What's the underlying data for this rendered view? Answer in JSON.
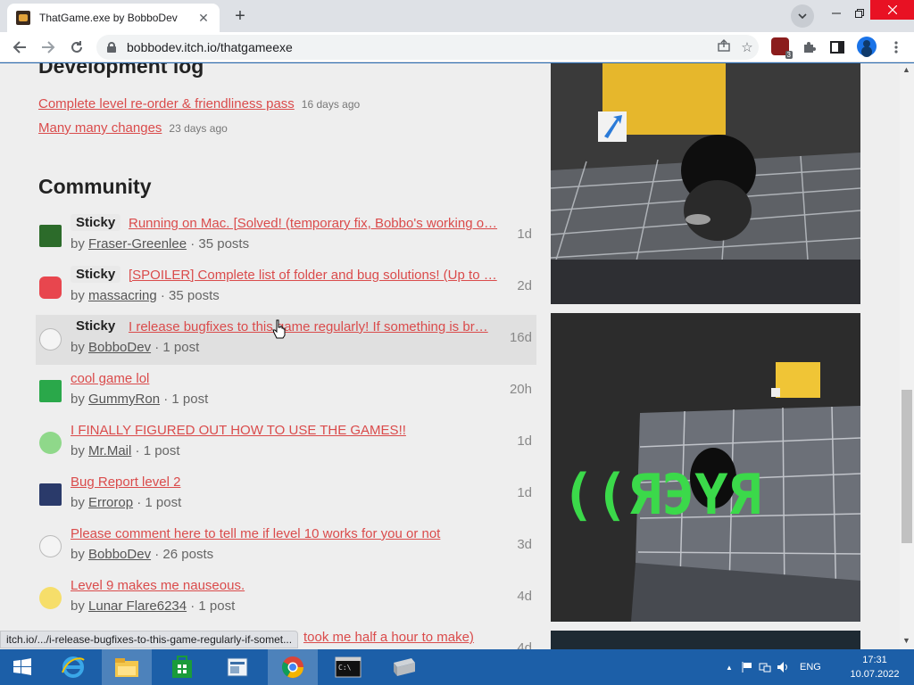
{
  "browser": {
    "tab_title": "ThatGame.exe by BobboDev",
    "tab_close": "✕",
    "new_tab": "+",
    "url": "bobbodev.itch.io/thatgameexe",
    "extension_count": "3"
  },
  "devlog": {
    "heading": "Development log",
    "items": [
      {
        "title": "Complete level re-order & friendliness pass",
        "ago": "16 days ago"
      },
      {
        "title": "Many many changes",
        "ago": "23 days ago"
      }
    ]
  },
  "community": {
    "heading": "Community",
    "sticky_label": "Sticky",
    "by": "by ",
    "topics": [
      {
        "sticky": true,
        "title": "Running on Mac. [Solved! (temporary fix, Bobbo's working o…",
        "user": "Fraser-Greenlee",
        "posts": " · 35 posts",
        "age": "1d",
        "avatar_color": "#2c6b2a"
      },
      {
        "sticky": true,
        "title": "[SPOILER] Complete list of folder and bug solutions! (Up to …",
        "user": "massacring",
        "posts": " · 35 posts",
        "age": "2d",
        "avatar_color": "#e8464e"
      },
      {
        "sticky": true,
        "title": "I release bugfixes to this game regularly! If something is br…",
        "user": "BobboDev",
        "posts": " · 1 post",
        "age": "16d",
        "avatar_color": "#f4f4f4"
      },
      {
        "sticky": false,
        "title": "cool game lol",
        "user": "GummyRon",
        "posts": " · 1 post",
        "age": "20h",
        "avatar_color": "#2aa84a"
      },
      {
        "sticky": false,
        "title": "I FINALLY FIGURED OUT HOW TO USE THE GAMES!!",
        "user": "Mr.Mail",
        "posts": " · 1 post",
        "age": "1d",
        "avatar_color": "#8fd88a"
      },
      {
        "sticky": false,
        "title": "Bug Report level 2",
        "user": "Errorop",
        "posts": " · 1 post",
        "age": "1d",
        "avatar_color": "#2a3a6a"
      },
      {
        "sticky": false,
        "title": "Please comment here to tell me if level 10 works for you or not",
        "user": "BobboDev",
        "posts": " · 26 posts",
        "age": "3d",
        "avatar_color": "#f4f4f4"
      },
      {
        "sticky": false,
        "title": "Level 9 makes me nauseous.",
        "user": "Lunar Flare6234",
        "posts": " · 1 post",
        "age": "4d",
        "avatar_color": "#f6de6a"
      },
      {
        "sticky": false,
        "title": "took me half a hour to make)",
        "user": "",
        "posts": "",
        "age": "4d",
        "avatar_color": "#eeeeee"
      }
    ]
  },
  "status_tip": "itch.io/.../i-release-bugfixes-to-this-game-regularly-if-somet...",
  "screenshot2_text": "((ЯЭYЯ",
  "taskbar": {
    "lang": "ENG",
    "time": "17:31",
    "date": "10.07.2022"
  },
  "colors": {
    "link": "#da4b4b",
    "taskbar": "#1c5fa8",
    "game_text_green": "#3bd94a"
  }
}
